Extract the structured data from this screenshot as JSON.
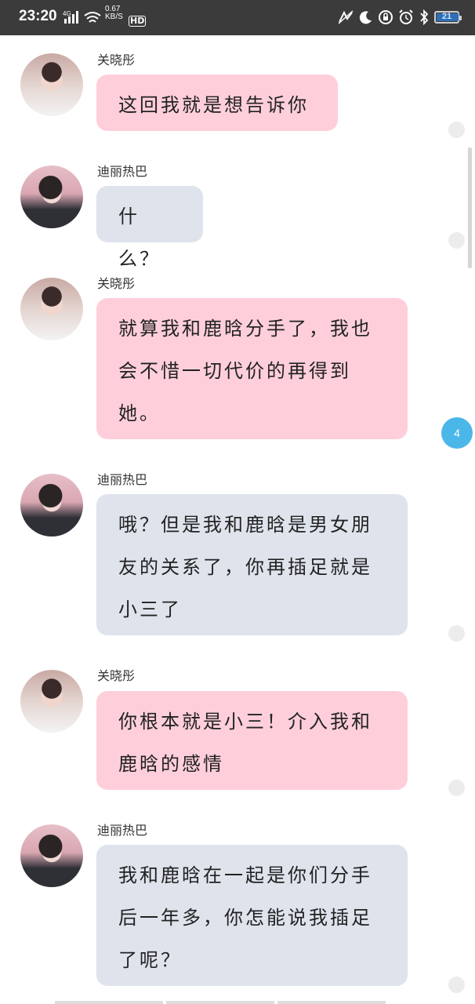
{
  "status_bar": {
    "time": "23:20",
    "network_type": "4G",
    "speed_value": "0.67",
    "speed_unit": "KB/S",
    "hd_label": "HD",
    "battery_level": "21"
  },
  "messages": [
    {
      "sender": "关晓彤",
      "text": "这回我就是想告诉你"
    },
    {
      "sender": "迪丽热巴",
      "text": "什么？"
    },
    {
      "sender": "关晓彤",
      "text": "就算我和鹿晗分手了，我也会不惜一切代价的再得到她。"
    },
    {
      "sender": "迪丽热巴",
      "text": "哦？但是我和鹿晗是男女朋友的关系了，你再插足就是小三了"
    },
    {
      "sender": "关晓彤",
      "text": "你根本就是小三！介入我和鹿晗的感情"
    },
    {
      "sender": "迪丽热巴",
      "text": "我和鹿晗在一起是你们分手后一年多，你怎能说我插足了呢？"
    }
  ],
  "unread_badge": "4"
}
